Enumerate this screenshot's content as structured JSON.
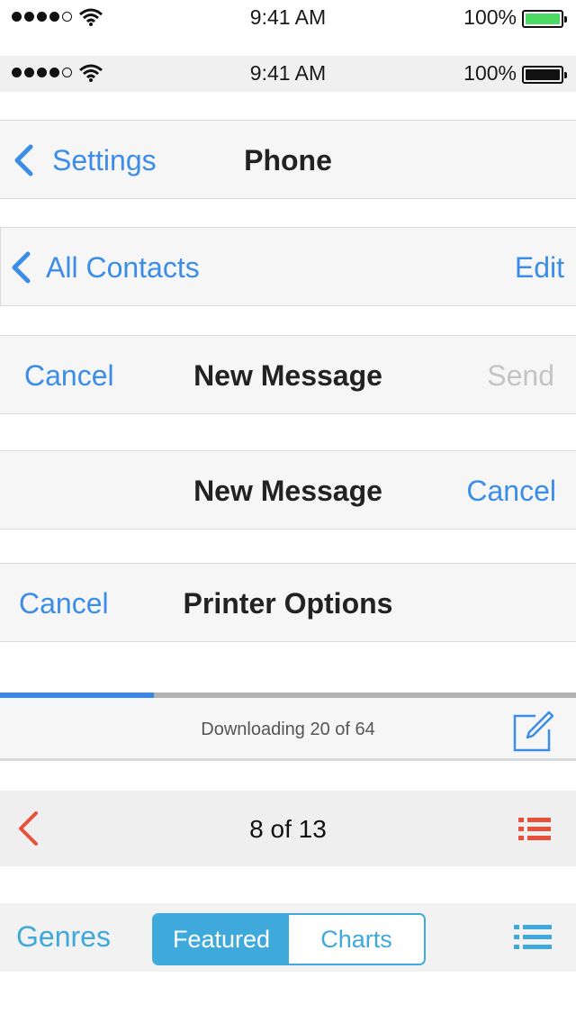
{
  "status_bar_light": {
    "time": "9:41 AM",
    "battery": "100%",
    "battery_color": "#4cd964"
  },
  "status_bar_gray": {
    "time": "9:41 AM",
    "battery": "100%",
    "battery_color": "#111111"
  },
  "nav_settings": {
    "back_label": "Settings",
    "title": "Phone"
  },
  "nav_contacts": {
    "back_label": "All Contacts",
    "edit_label": "Edit"
  },
  "nav_new_message_1": {
    "cancel_label": "Cancel",
    "title": "New Message",
    "send_label": "Send"
  },
  "nav_new_message_2": {
    "title": "New Message",
    "cancel_label": "Cancel"
  },
  "nav_printer": {
    "cancel_label": "Cancel",
    "title": "Printer Options"
  },
  "download_bar": {
    "status": "Downloading 20 of 64",
    "progress": 0.267
  },
  "pager_bar": {
    "current": "8",
    "separator": " of ",
    "total": "13"
  },
  "store_bar": {
    "genres_label": "Genres",
    "segments": [
      "Featured",
      "Charts"
    ],
    "selected": "Featured"
  },
  "colors": {
    "accent_blue": "#3b8de8",
    "red": "#e8503a",
    "store_blue": "#3fa9dc"
  }
}
